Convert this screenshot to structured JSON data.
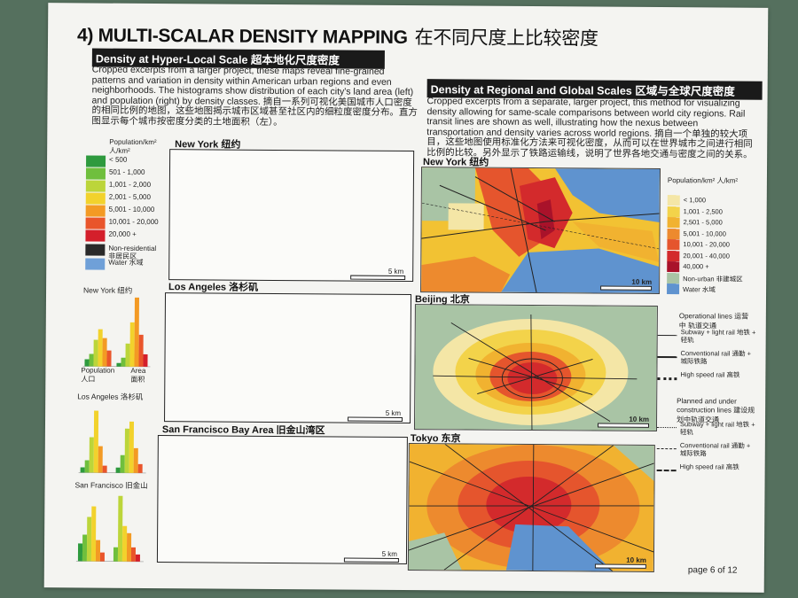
{
  "title": {
    "en": "4) MULTI-SCALAR DENSITY MAPPING",
    "cn": "在不同尺度上比较密度"
  },
  "hyperlocal": {
    "heading": "Density at Hyper-Local Scale 超本地化尺度密度",
    "text": "Cropped excerpts from a larger project, these maps reveal fine-grained patterns and variation in density within American urban regions and even neighborhoods. The histograms show distribution of each city's land area (left) and population (right) by density classes. 摘自一系列可视化美国城市人口密度的相同比例的地图，这些地图揭示城市区域甚至社区内的细粒度密度分布。直方图显示每个城市按密度分类的土地面积（左）。",
    "legend_title": "Population/km² 人/km²",
    "legend": [
      {
        "label": "< 500",
        "color": "#2e9a3e"
      },
      {
        "label": "501 - 1,000",
        "color": "#6fbf3d"
      },
      {
        "label": "1,001 - 2,000",
        "color": "#bcd53a"
      },
      {
        "label": "2,001 - 5,000",
        "color": "#f2d22c"
      },
      {
        "label": "5,001 - 10,000",
        "color": "#f39a24"
      },
      {
        "label": "10,001 - 20,000",
        "color": "#e9552b"
      },
      {
        "label": "20,000 +",
        "color": "#d41f2b"
      },
      {
        "label": "Non-residential 非居民区",
        "color": "#2a2a2a"
      },
      {
        "label": "Water 水域",
        "color": "#6fa0d8"
      }
    ],
    "maps": [
      {
        "label": "New York 纽约",
        "scale": "5 km"
      },
      {
        "label": "Los Angeles 洛杉矶",
        "scale": "5 km"
      },
      {
        "label": "San Francisco Bay Area 旧金山湾区",
        "scale": "5 km"
      }
    ],
    "histograms": [
      {
        "label": "New York 纽约",
        "population_label": "Population 人口",
        "area_label": "Area 面积"
      },
      {
        "label": "Los Angeles 洛杉矶"
      },
      {
        "label": "San Francisco 旧金山"
      }
    ]
  },
  "regional": {
    "heading": "Density at Regional and Global Scales 区域与全球尺度密度",
    "text": "Cropped excerpts from a separate, larger project, this method for visualizing density allowing for same-scale comparisons between world city regions. Rail transit lines are shown as well, illustrating how the nexus between transportation and density varies across world regions. 摘自一个单独的较大项目，这些地图使用标准化方法来可视化密度，从而可以在世界城市之间进行相同比例的比较。另外显示了铁路运输线，说明了世界各地交通与密度之间的关系。",
    "legend_title": "Population/km² 人/km²",
    "legend": [
      {
        "label": "< 1,000",
        "color": "#f4e6a6"
      },
      {
        "label": "1,001 - 2,500",
        "color": "#f3d34a"
      },
      {
        "label": "2,501 - 5,000",
        "color": "#f1b230"
      },
      {
        "label": "5,001 - 10,000",
        "color": "#ed8a2e"
      },
      {
        "label": "10,001 - 20,000",
        "color": "#e5552d"
      },
      {
        "label": "20,001 - 40,000",
        "color": "#d32a2c"
      },
      {
        "label": "40,000 +",
        "color": "#a9122a"
      },
      {
        "label": "Non-urban 非建城区",
        "color": "#a9c4a5"
      },
      {
        "label": "Water 水域",
        "color": "#5f93cf"
      }
    ],
    "maps": [
      {
        "label": "New York 纽约",
        "scale": "10 km"
      },
      {
        "label": "Beijing 北京",
        "scale": "10 km"
      },
      {
        "label": "Tokyo 东京",
        "scale": "10 km"
      }
    ],
    "lines_legend": {
      "operational_title": "Operational lines 运营中 轨道交通",
      "operational": [
        {
          "label": "Subway + light rail 地铁 + 轻轨",
          "style": "solid-thin"
        },
        {
          "label": "Conventional rail 通勤 + 城际铁路",
          "style": "solid"
        },
        {
          "label": "High speed rail 高铁",
          "style": "hatched"
        }
      ],
      "planned_title": "Planned and under construction lines 建设规划中轨道交通",
      "planned": [
        {
          "label": "Subway + light rail 地铁 + 轻轨",
          "style": "dotted"
        },
        {
          "label": "Conventional rail 通勤 + 城际铁路",
          "style": "dashed"
        },
        {
          "label": "High speed rail 高铁",
          "style": "dash-hatched"
        }
      ]
    }
  },
  "page": "page 6 of 12",
  "colors": {
    "paper": "#f4f4f1",
    "background": "#55705e",
    "heading_bg": "#1a1a1a"
  }
}
